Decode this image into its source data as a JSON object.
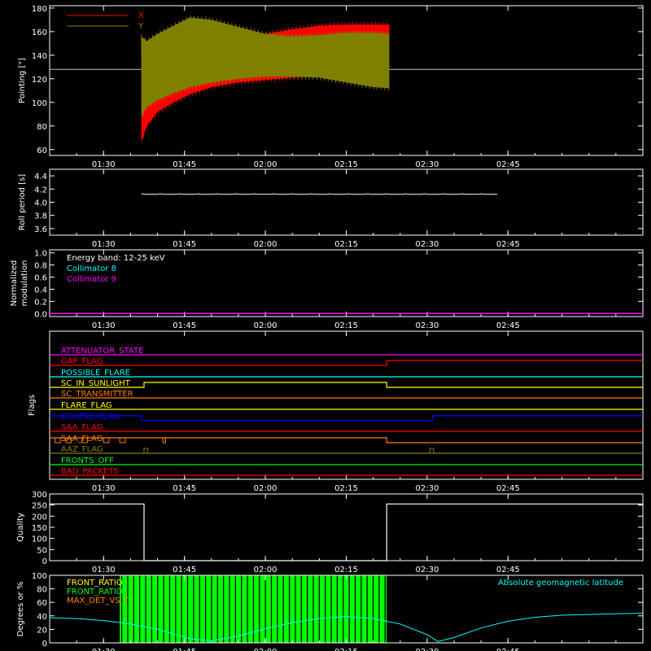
{
  "time_axis": {
    "range_min": [
      80,
      190
    ],
    "ticks": [
      {
        "label": "01:30",
        "t": 90
      },
      {
        "label": "01:45",
        "t": 105
      },
      {
        "label": "02:00",
        "t": 120
      },
      {
        "label": "02:15",
        "t": 135
      },
      {
        "label": "02:30",
        "t": 150
      },
      {
        "label": "02:45",
        "t": 165
      }
    ]
  },
  "chart_data": [
    {
      "id": "pointing",
      "type": "area",
      "ylabel": "Pointing [\"]",
      "ylim": [
        55,
        182
      ],
      "yticks": [
        60,
        80,
        100,
        120,
        140,
        160,
        180
      ],
      "reference_line": 128,
      "legend": [
        {
          "name": "X",
          "color": "#ff0000"
        },
        {
          "name": "Y",
          "color": "#808000"
        }
      ],
      "series": [
        {
          "name": "X",
          "color": "#ff0000",
          "t": [
            97,
            98,
            100,
            103,
            106,
            110,
            115,
            120,
            125,
            130,
            135,
            140,
            143
          ],
          "upper": [
            148,
            150,
            153,
            156,
            157,
            157,
            156,
            158,
            162,
            165,
            166,
            166,
            166
          ],
          "lower": [
            66,
            80,
            92,
            100,
            107,
            113,
            117,
            119,
            121,
            122,
            122,
            122,
            120
          ]
        },
        {
          "name": "Y",
          "color": "#808000",
          "t": [
            97,
            98,
            100,
            103,
            106,
            110,
            115,
            120,
            125,
            130,
            135,
            140,
            143
          ],
          "upper": [
            156,
            152,
            158,
            165,
            172,
            170,
            164,
            158,
            156,
            157,
            159,
            159,
            158
          ],
          "lower": [
            88,
            96,
            102,
            108,
            113,
            117,
            120,
            122,
            122,
            121,
            117,
            113,
            112
          ]
        }
      ]
    },
    {
      "id": "roll",
      "type": "line",
      "ylabel": "Roll period [s]",
      "ylim": [
        3.5,
        4.5
      ],
      "yticks": [
        "3.6",
        "3.8",
        "4.0",
        "4.2",
        "4.4"
      ],
      "series": [
        {
          "name": "roll",
          "color": "#ffffff",
          "t": [
            97,
            110,
            120,
            130,
            143,
            150,
            160,
            163
          ],
          "values": [
            4.12,
            4.12,
            4.12,
            4.12,
            4.12,
            4.12,
            4.12,
            4.12
          ]
        }
      ]
    },
    {
      "id": "modulation",
      "type": "line",
      "ylabel": "Normalized modulation",
      "ylim": [
        -0.05,
        1.05
      ],
      "yticks": [
        "0.0",
        "0.2",
        "0.4",
        "0.6",
        "0.8",
        "1.0"
      ],
      "legend": [
        {
          "name": "Energy band: 12-25 keV",
          "color": "#ffffff"
        },
        {
          "name": "Collimator 8",
          "color": "#00ffff"
        },
        {
          "name": "Collimator 9",
          "color": "#ff00ff"
        }
      ],
      "series": [
        {
          "name": "Collimator 9",
          "color": "#ff00ff",
          "t": [
            80,
            190
          ],
          "values": [
            0,
            0
          ]
        }
      ]
    },
    {
      "id": "flags",
      "type": "line",
      "ylabel": "Flags",
      "rows": [
        {
          "name": "ATTENUATOR_STATE",
          "color": "#ff00ff",
          "segments": [
            [
              80,
              190,
              0
            ]
          ]
        },
        {
          "name": "GAP_FLAG",
          "color": "#ff0000",
          "segments": [
            [
              80,
              142.5,
              0
            ],
            [
              142.5,
              190,
              1
            ]
          ]
        },
        {
          "name": "POSSIBLE_FLARE",
          "color": "#00ffff",
          "segments": [
            [
              80,
              190,
              0
            ]
          ]
        },
        {
          "name": "SC_IN_SUNLIGHT",
          "color": "#ffff00",
          "segments": [
            [
              80,
              97.5,
              0
            ],
            [
              97.5,
              142.5,
              1
            ],
            [
              142.5,
              190,
              0
            ]
          ]
        },
        {
          "name": "SC_TRANSMITTER",
          "color": "#ff8000",
          "segments": [
            [
              80,
              190,
              0
            ]
          ]
        },
        {
          "name": "FLARE_FLAG",
          "color": "#ffff00",
          "segments": [
            [
              80,
              190,
              0
            ]
          ]
        },
        {
          "name": "ECLIPSE_FLAG",
          "color": "#0000ff",
          "segments": [
            [
              80,
              97,
              1
            ],
            [
              97,
              151,
              0
            ],
            [
              151,
              190,
              1
            ]
          ]
        },
        {
          "name": "SAA_FLAG",
          "color": "#ff0000",
          "segments": [
            [
              80,
              190,
              0
            ]
          ]
        },
        {
          "name": "SAA_FLAG",
          "color": "#ff8000",
          "segments": [
            [
              80,
              142.5,
              1
            ],
            [
              142.5,
              190,
              0
            ]
          ]
        },
        {
          "name": "AAZ_FLAG",
          "color": "#808000",
          "segments": [
            [
              80,
              190,
              0
            ]
          ]
        },
        {
          "name": "FRONTS_OFF",
          "color": "#00ff00",
          "segments": [
            [
              80,
              190,
              0
            ]
          ]
        },
        {
          "name": "BAD_PACKETS",
          "color": "#ff0000",
          "segments": [
            [
              80,
              190,
              0
            ]
          ]
        }
      ]
    },
    {
      "id": "quality",
      "type": "line",
      "ylabel": "Quality",
      "ylim": [
        0,
        300
      ],
      "yticks": [
        0,
        50,
        100,
        150,
        200,
        250,
        300
      ],
      "series": [
        {
          "name": "quality",
          "color": "#ffffff",
          "t": [
            80,
            97.5,
            97.5,
            142.5,
            142.5,
            190
          ],
          "values": [
            255,
            255,
            0,
            0,
            255,
            255
          ]
        }
      ]
    },
    {
      "id": "front_ratio",
      "type": "line",
      "ylabel": "Degrees or %",
      "ylim": [
        0,
        100
      ],
      "yticks": [
        0,
        20,
        40,
        60,
        80,
        100
      ],
      "legend": [
        {
          "name": "FRONT_RATIO",
          "color": "#ffff00"
        },
        {
          "name": "FRONT_RATIO_",
          "color": "#00ff00"
        },
        {
          "name": "MAX_DET_VS_T",
          "color": "#ff8000"
        }
      ],
      "annotation": {
        "text": "Absolute geomagnetic latitude",
        "color": "#00ffff"
      },
      "green_band": [
        93,
        142.5
      ],
      "series": [
        {
          "name": "Absolute geomagnetic latitude",
          "color": "#00ffff",
          "t": [
            80,
            85,
            90,
            95,
            100,
            103,
            106,
            110,
            115,
            120,
            125,
            130,
            135,
            140,
            145,
            150,
            152,
            155,
            160,
            165,
            170,
            175,
            180,
            185,
            190
          ],
          "values": [
            37,
            36,
            33,
            28,
            20,
            13,
            6,
            3,
            10,
            21,
            30,
            36,
            39,
            36,
            28,
            12,
            2,
            8,
            22,
            32,
            38,
            41,
            42,
            43,
            44
          ]
        }
      ]
    }
  ]
}
